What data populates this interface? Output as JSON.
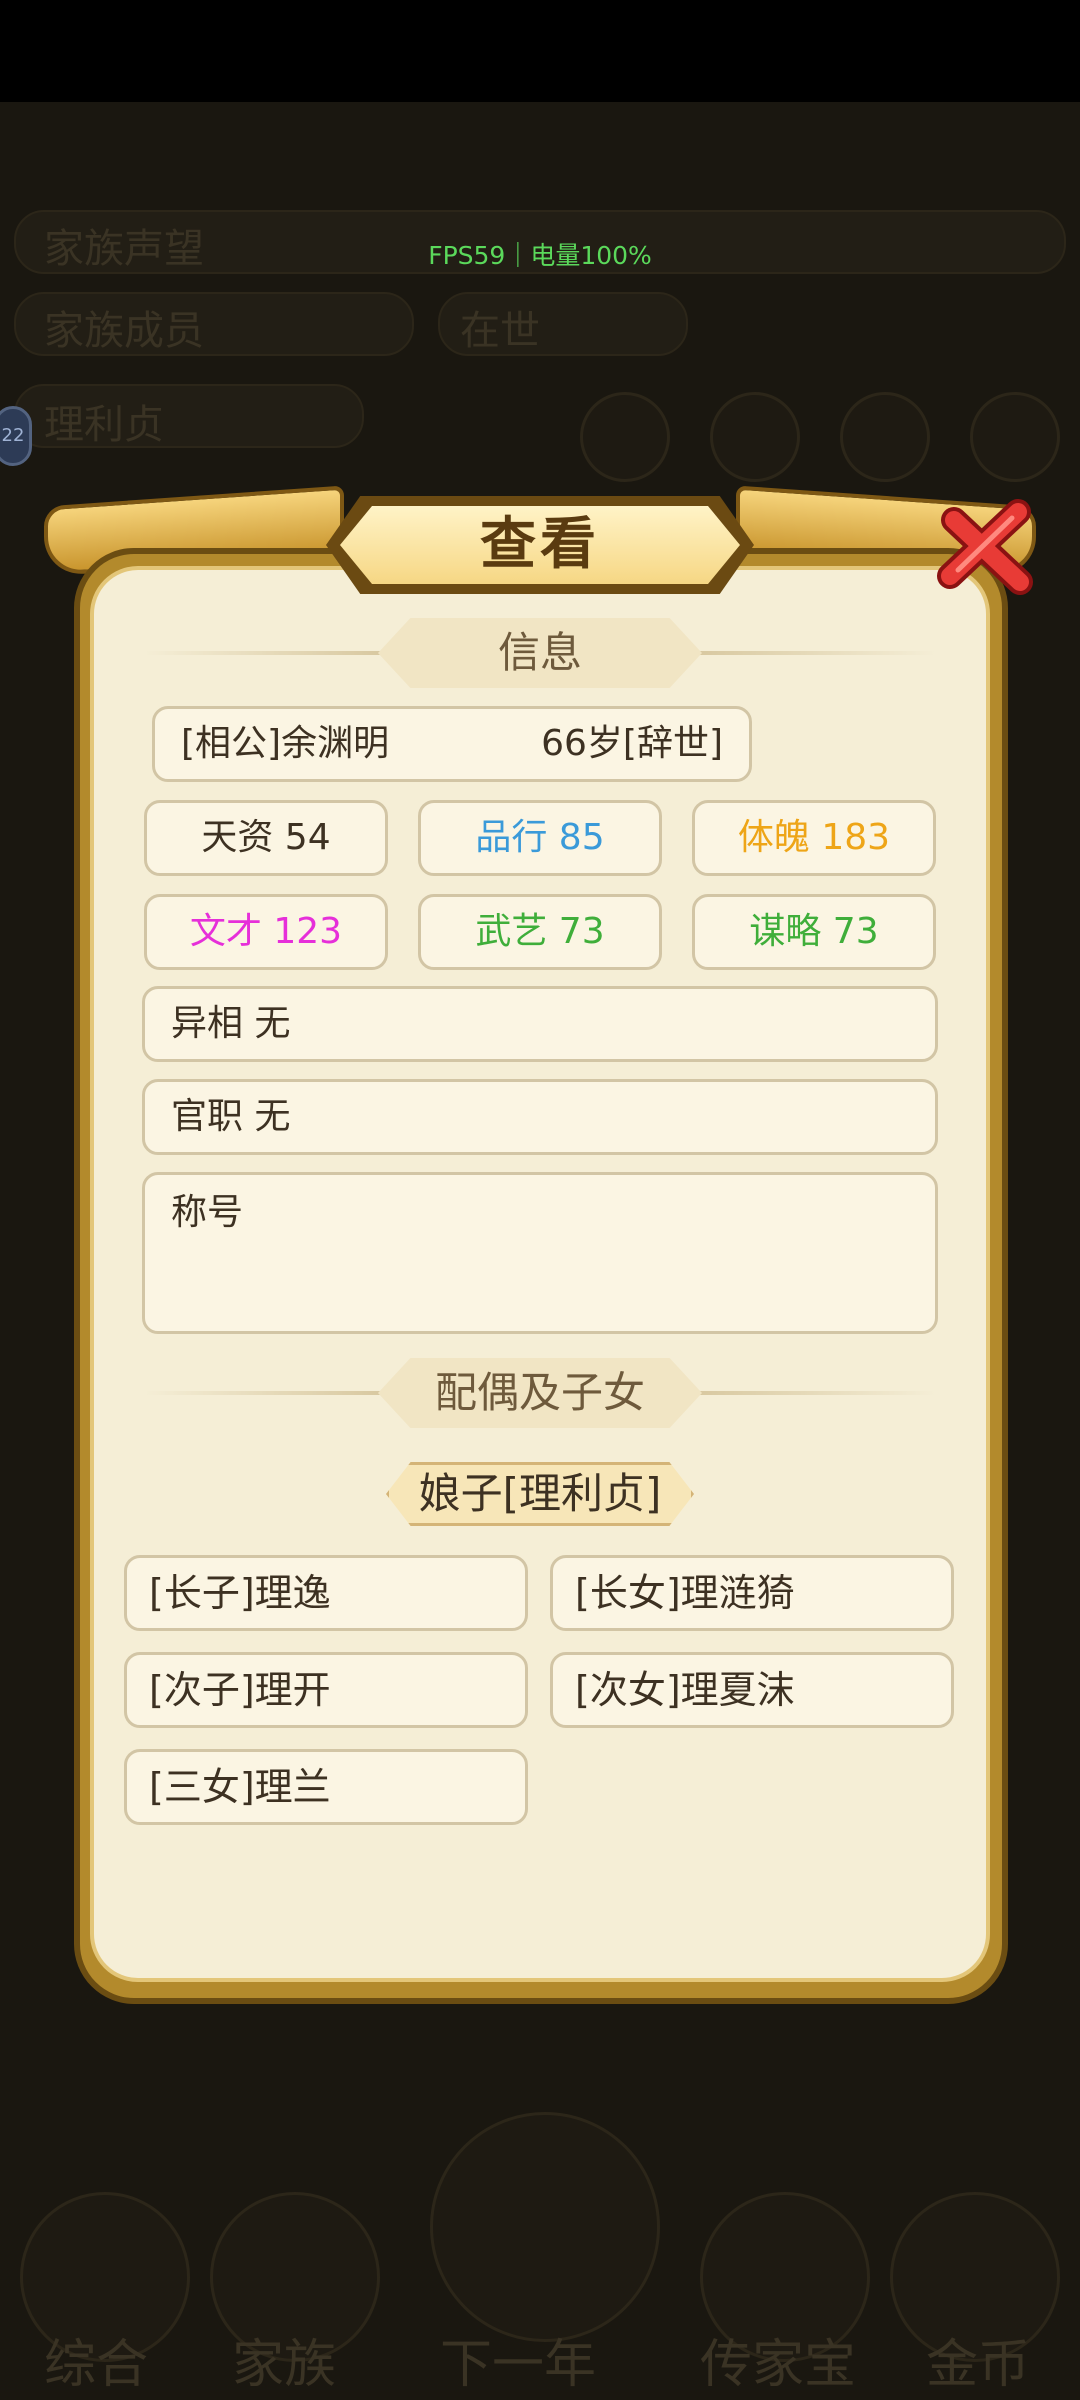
{
  "overlay": {
    "fps_text": "FPS59｜电量100%"
  },
  "dialog": {
    "title": "查看",
    "info_section": "信息",
    "person_label": "[相公]余渊明",
    "person_age": "66岁[辞世]",
    "stats": [
      {
        "label": "天资 54",
        "color": "#3d3122"
      },
      {
        "label": "品行 85",
        "color": "#3a9ad9"
      },
      {
        "label": "体魄 183",
        "color": "#eea517"
      },
      {
        "label": "文才 123",
        "color": "#e62fd9"
      },
      {
        "label": "武艺 73",
        "color": "#3fae3a"
      },
      {
        "label": "谋略 73",
        "color": "#3fae3a"
      }
    ],
    "trait": "异相 无",
    "office": "官职 无",
    "titles_label": "称号",
    "family_section": "配偶及子女",
    "spouse": "娘子[理利贞]",
    "children": [
      "[长子]理逸",
      "[长女]理涟猗",
      "[次子]理开",
      "[次女]理夏沫",
      "[三女]理兰"
    ]
  },
  "background": {
    "badge": "22",
    "row1_left": "家族声望",
    "row2_left": "家族成员",
    "row2_mid": "在世",
    "row3_left": "理利贞",
    "bottom_nav": [
      "综合",
      "家族",
      "下一年",
      "传家宝",
      "金币"
    ]
  }
}
